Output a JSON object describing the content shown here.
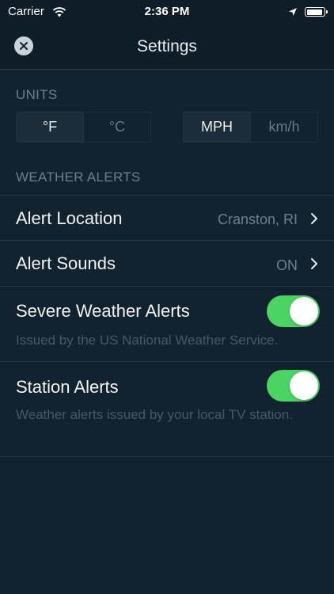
{
  "status_bar": {
    "carrier": "Carrier",
    "time": "2:36 PM"
  },
  "nav": {
    "title": "Settings"
  },
  "units": {
    "header": "UNITS",
    "temperature": {
      "options": [
        "°F",
        "°C"
      ],
      "selected": "°F"
    },
    "speed": {
      "options": [
        "MPH",
        "km/h"
      ],
      "selected": "MPH"
    }
  },
  "weather_alerts": {
    "header": "WEATHER ALERTS",
    "alert_location": {
      "label": "Alert Location",
      "value": "Cranston, RI"
    },
    "alert_sounds": {
      "label": "Alert Sounds",
      "value": "ON"
    },
    "severe_weather": {
      "label": "Severe Weather Alerts",
      "description": "Issued by the US National Weather Service.",
      "enabled": true
    },
    "station_alerts": {
      "label": "Station Alerts",
      "description": "Weather alerts issued by your local TV station.",
      "enabled": true
    }
  },
  "colors": {
    "background": "#12222e",
    "toggle_on": "#4bd364",
    "muted_text": "#6b7f8d"
  }
}
